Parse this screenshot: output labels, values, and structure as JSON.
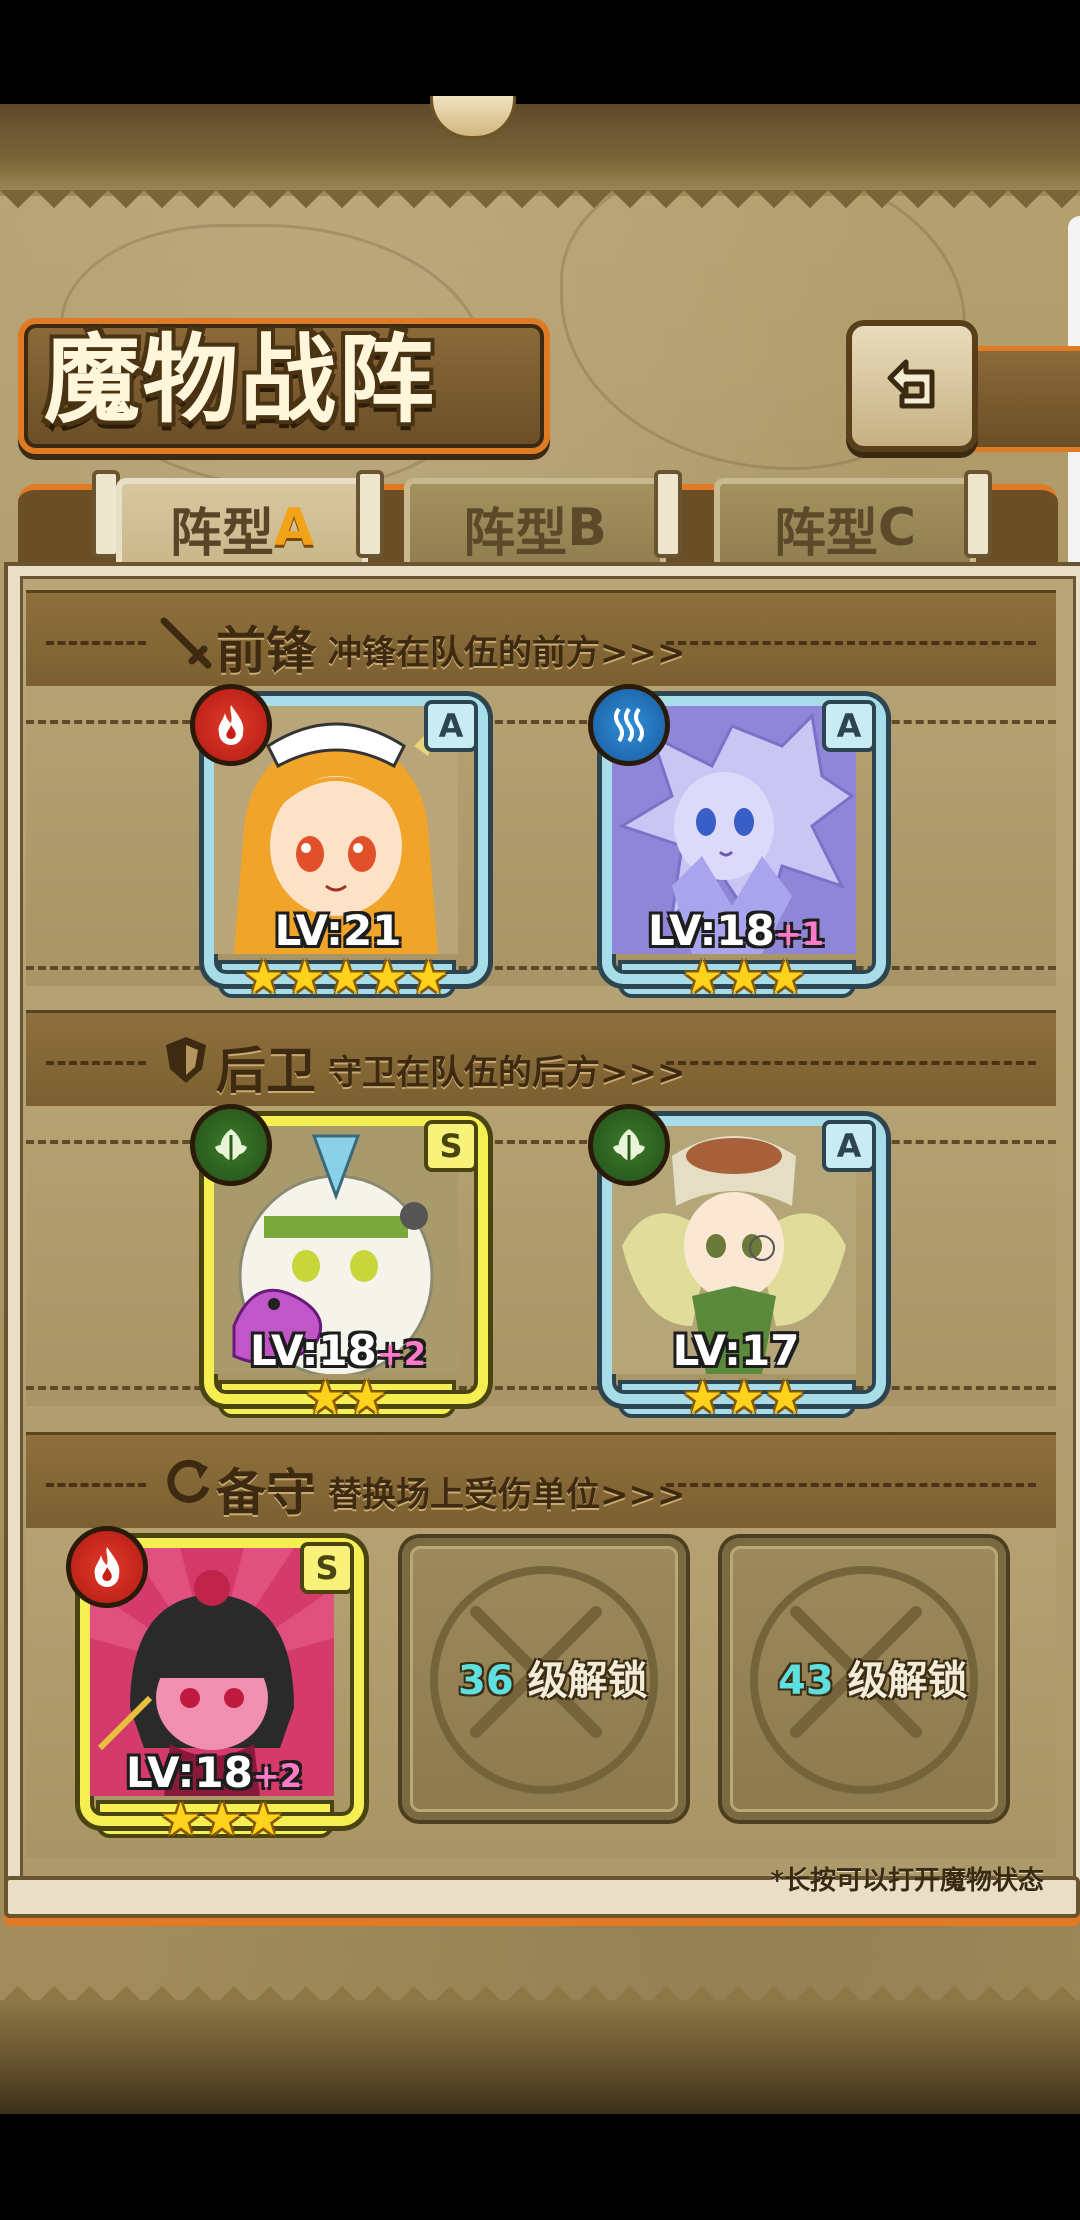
{
  "title": "魔物战阵",
  "tabs": [
    {
      "prefix": "阵型",
      "letter": "A",
      "active": true
    },
    {
      "prefix": "阵型",
      "letter": "B",
      "active": false
    },
    {
      "prefix": "阵型",
      "letter": "C",
      "active": false
    }
  ],
  "sections": {
    "vanguard": {
      "title": "前锋",
      "desc": "冲锋在队伍的前方>>>"
    },
    "rearguard": {
      "title": "后卫",
      "desc": "守卫在队伍的后方>>>"
    },
    "reserve": {
      "title": "备守",
      "desc": "替换场上受伤单位>>>"
    }
  },
  "cards": [
    {
      "element": "fire",
      "rank": "A",
      "level": "LV:21",
      "plus": "",
      "stars": 5
    },
    {
      "element": "water",
      "rank": "A",
      "level": "LV:18",
      "plus": "+1",
      "stars": 3
    },
    {
      "element": "grass",
      "rank": "S",
      "level": "LV:18",
      "plus": "+2",
      "stars": 2
    },
    {
      "element": "grass",
      "rank": "A",
      "level": "LV:17",
      "plus": "",
      "stars": 3
    },
    {
      "element": "fire",
      "rank": "S",
      "level": "LV:18",
      "plus": "+2",
      "stars": 3
    }
  ],
  "locked_slots": [
    {
      "level": "36",
      "label": "级解锁"
    },
    {
      "level": "43",
      "label": "级解锁"
    }
  ],
  "footer_hint": "*长按可以打开魔物状态",
  "icons": {
    "back": "back-arrow-icon",
    "fire": "flame-icon",
    "water": "wave-icon",
    "grass": "leaf-icon",
    "vanguard": "sword-icon",
    "rearguard": "shield-icon",
    "reserve": "refresh-icon",
    "lock": "x-lock-icon"
  },
  "colors": {
    "tab_accent": "#f2a319",
    "banner_border": "#e07b23",
    "rank_a_frame": "#a6dde8",
    "rank_s_frame": "#f5ef52",
    "plus_text": "#ff7bc8",
    "lock_number": "#5fe0e0"
  }
}
